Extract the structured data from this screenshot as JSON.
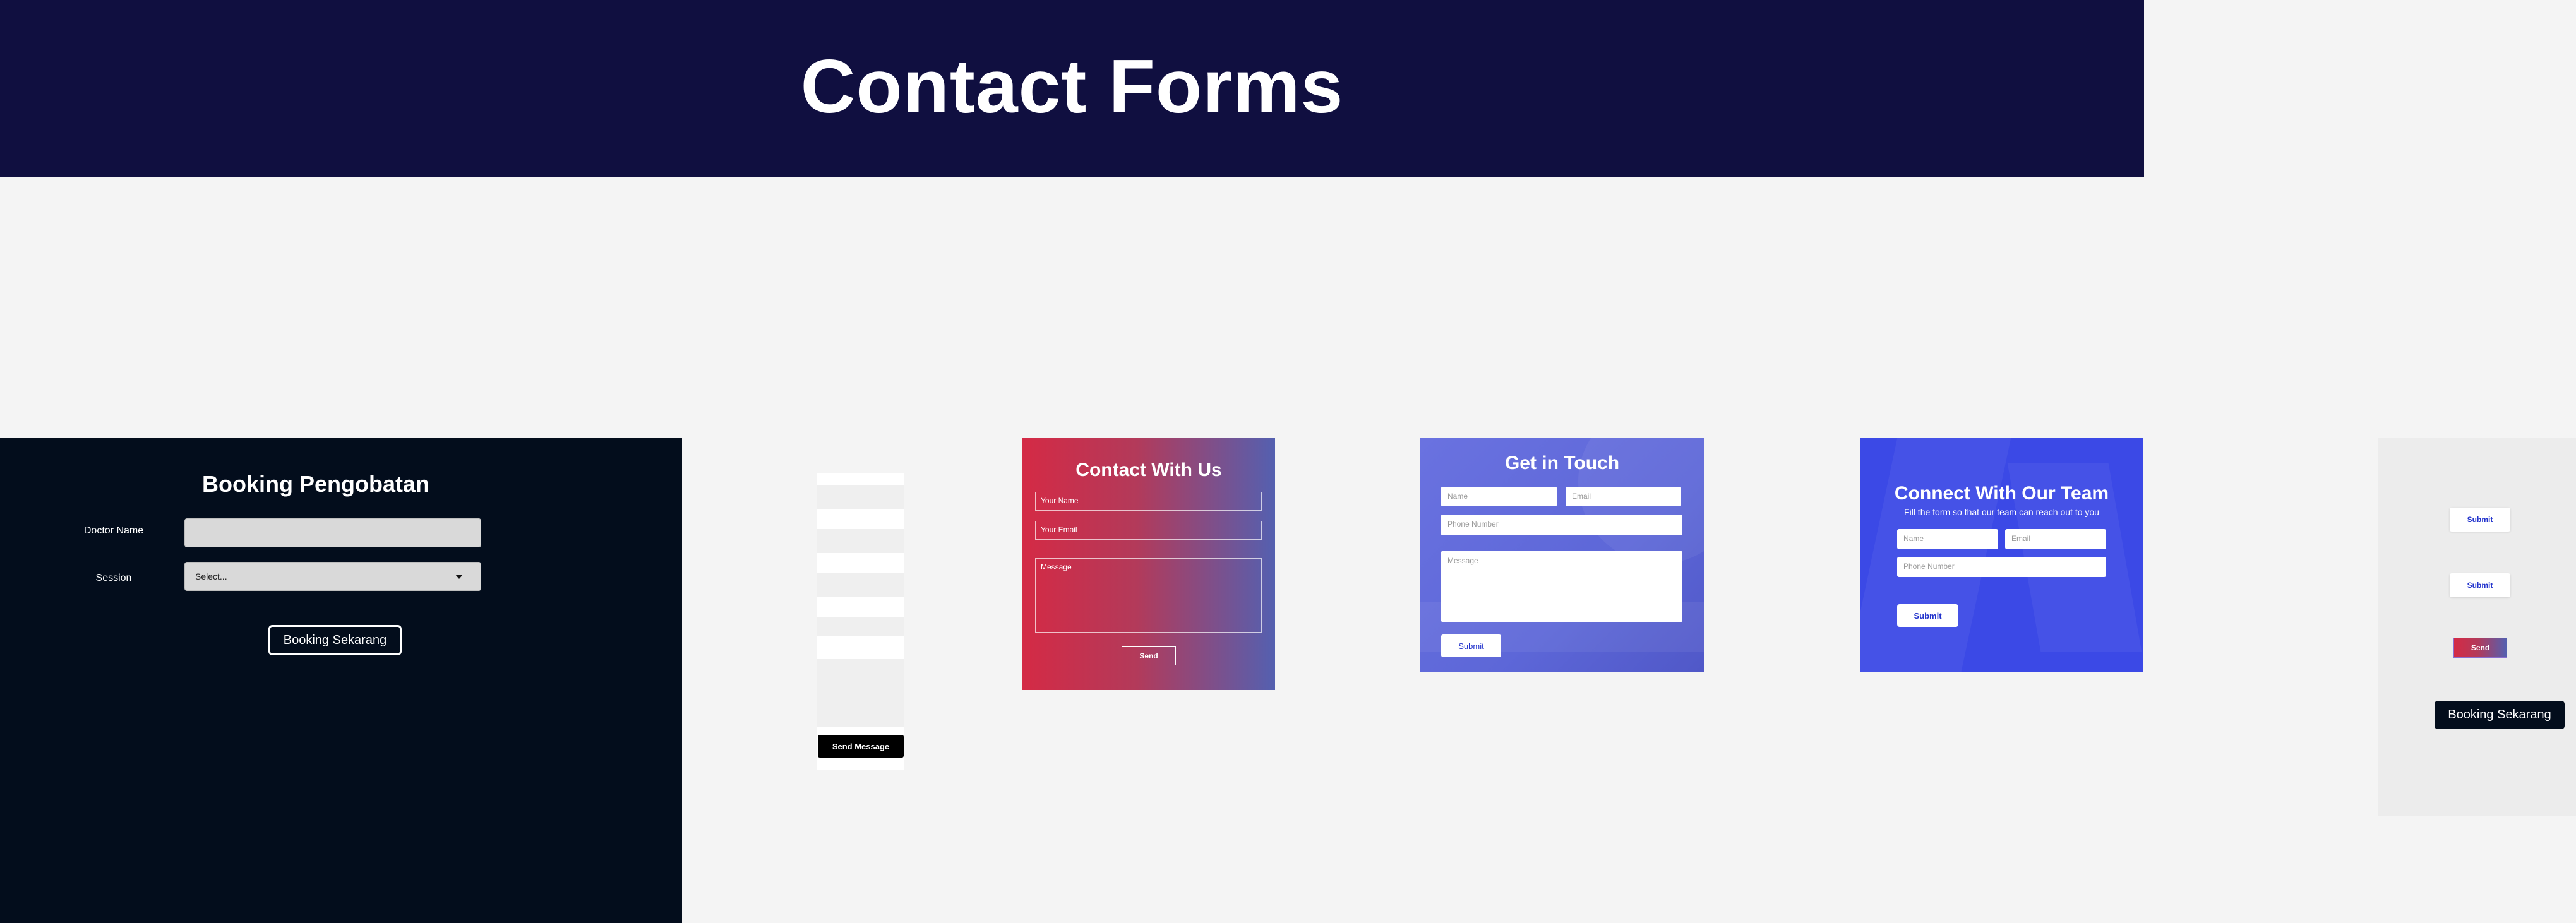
{
  "page": {
    "title": "Contact Forms"
  },
  "booking_form": {
    "title": "Booking Pengobatan",
    "doctor_label": "Doctor Name",
    "doctor_value": "",
    "session_label": "Session",
    "session_selected": "Select...",
    "submit_label": "Booking Sekarang",
    "bg_color": "#030d1c"
  },
  "skeleton_form": {
    "submit_label": "Send Message"
  },
  "contact_with_us": {
    "title": "Contact With Us",
    "name_placeholder": "Your Name",
    "email_placeholder": "Your Email",
    "message_placeholder": "Message",
    "submit_label": "Send",
    "gradient": [
      "#d42a45",
      "#5460b0"
    ]
  },
  "get_in_touch": {
    "title": "Get in Touch",
    "name_placeholder": "Name",
    "email_placeholder": "Email",
    "phone_placeholder": "Phone Number",
    "message_placeholder": "Message",
    "submit_label": "Submit",
    "bg_color": "#5d67d8"
  },
  "connect_team": {
    "title": "Connect With Our Team",
    "subtitle": "Fill the form so that our team can reach out to you",
    "name_placeholder": "Name",
    "email_placeholder": "Email",
    "phone_placeholder": "Phone Number",
    "submit_label": "Submit",
    "bg_color": "#3b49e6"
  },
  "button_panel": {
    "submit_label_1": "Submit",
    "submit_label_2": "Submit",
    "send_label": "Send",
    "booking_label": "Booking Sekarang"
  }
}
